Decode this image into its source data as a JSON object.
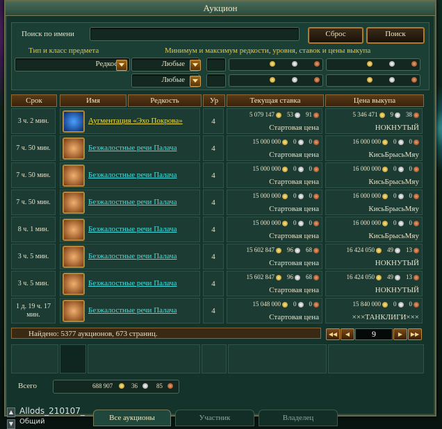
{
  "window": {
    "title": "Аукцион"
  },
  "search": {
    "name_label": "Поиск по имени",
    "name_value": "",
    "reset_label": "Сброс",
    "search_label": "Поиск",
    "type_label": "Тип и класс предмета",
    "range_label": "Минимум и максимум редкости, уровня, ставок и цены выкупа",
    "rarity_label": "Редкости",
    "any1": "Любые",
    "any2": "Любые"
  },
  "table": {
    "headers": [
      "Срок",
      "Имя",
      "Редкость",
      "Ур",
      "Текущая ставка",
      "Цена выкупа"
    ],
    "rows": [
      {
        "time": "3 ч. 2 мин.",
        "name": "Аугментация «Эхо Покрова»",
        "name_color": "yellow",
        "icon": "augment-icon",
        "level": "4",
        "bid": [
          "5 079 147",
          "53",
          "91"
        ],
        "bid_label": "Стартовая цена",
        "buyout": [
          "5 346 471",
          "9",
          "38"
        ],
        "buyout_label": "НОКНУТЫЙ"
      },
      {
        "time": "7 ч. 50 мин.",
        "name": "Безжалостные речи Палача",
        "name_color": "cyan",
        "icon": "scroll-icon",
        "level": "4",
        "bid": [
          "15 000 000",
          "0",
          "0"
        ],
        "bid_label": "Стартовая цена",
        "buyout": [
          "16 000 000",
          "0",
          "0"
        ],
        "buyout_label": "КисьБрысьМяу"
      },
      {
        "time": "7 ч. 50 мин.",
        "name": "Безжалостные речи Палача",
        "name_color": "cyan",
        "icon": "scroll-icon",
        "level": "4",
        "bid": [
          "15 000 000",
          "0",
          "0"
        ],
        "bid_label": "Стартовая цена",
        "buyout": [
          "16 000 000",
          "0",
          "0"
        ],
        "buyout_label": "КисьБрысьМяу"
      },
      {
        "time": "7 ч. 50 мин.",
        "name": "Безжалостные речи Палача",
        "name_color": "cyan",
        "icon": "scroll-icon",
        "level": "4",
        "bid": [
          "15 000 000",
          "0",
          "0"
        ],
        "bid_label": "Стартовая цена",
        "buyout": [
          "16 000 000",
          "0",
          "0"
        ],
        "buyout_label": "КисьБрысьМяу"
      },
      {
        "time": "8 ч. 1 мин.",
        "name": "Безжалостные речи Палача",
        "name_color": "cyan",
        "icon": "scroll-icon",
        "level": "4",
        "bid": [
          "15 000 000",
          "0",
          "0"
        ],
        "bid_label": "Стартовая цена",
        "buyout": [
          "16 000 000",
          "0",
          "0"
        ],
        "buyout_label": "КисьБрысьМяу"
      },
      {
        "time": "3 ч. 5 мин.",
        "name": "Безжалостные речи Палача",
        "name_color": "cyan",
        "icon": "scroll-icon",
        "level": "4",
        "bid": [
          "15 602 847",
          "96",
          "68"
        ],
        "bid_label": "Стартовая цена",
        "buyout": [
          "16 424 050",
          "49",
          "13"
        ],
        "buyout_label": "НОКНУТЫЙ"
      },
      {
        "time": "3 ч. 5 мин.",
        "name": "Безжалостные речи Палача",
        "name_color": "cyan",
        "icon": "scroll-icon",
        "level": "4",
        "bid": [
          "15 602 847",
          "96",
          "68"
        ],
        "bid_label": "Стартовая цена",
        "buyout": [
          "16 424 050",
          "49",
          "13"
        ],
        "buyout_label": "НОКНУТЫЙ"
      },
      {
        "time": "1 д. 19 ч. 17 мин.",
        "name": "Безжалостные речи Палача",
        "name_color": "cyan",
        "icon": "scroll-icon",
        "level": "4",
        "bid": [
          "15 048 000",
          "0",
          "0"
        ],
        "bid_label": "Стартовая цена",
        "buyout": [
          "15 840 000",
          "0",
          "0"
        ],
        "buyout_label": "×××ТАНКЛИГИ×××"
      }
    ]
  },
  "status": {
    "found": "Найдено: 5377 аукционов, 673 страниц."
  },
  "pager": {
    "page": "9"
  },
  "total": {
    "label": "Всего",
    "gold": "688 907",
    "silver": "36",
    "copper": "85"
  },
  "tabs": {
    "all": "Все аукционы",
    "participant": "Участник",
    "owner": "Владелец"
  },
  "chat": {
    "name": "Allods_210107_",
    "channel": "Общий"
  }
}
